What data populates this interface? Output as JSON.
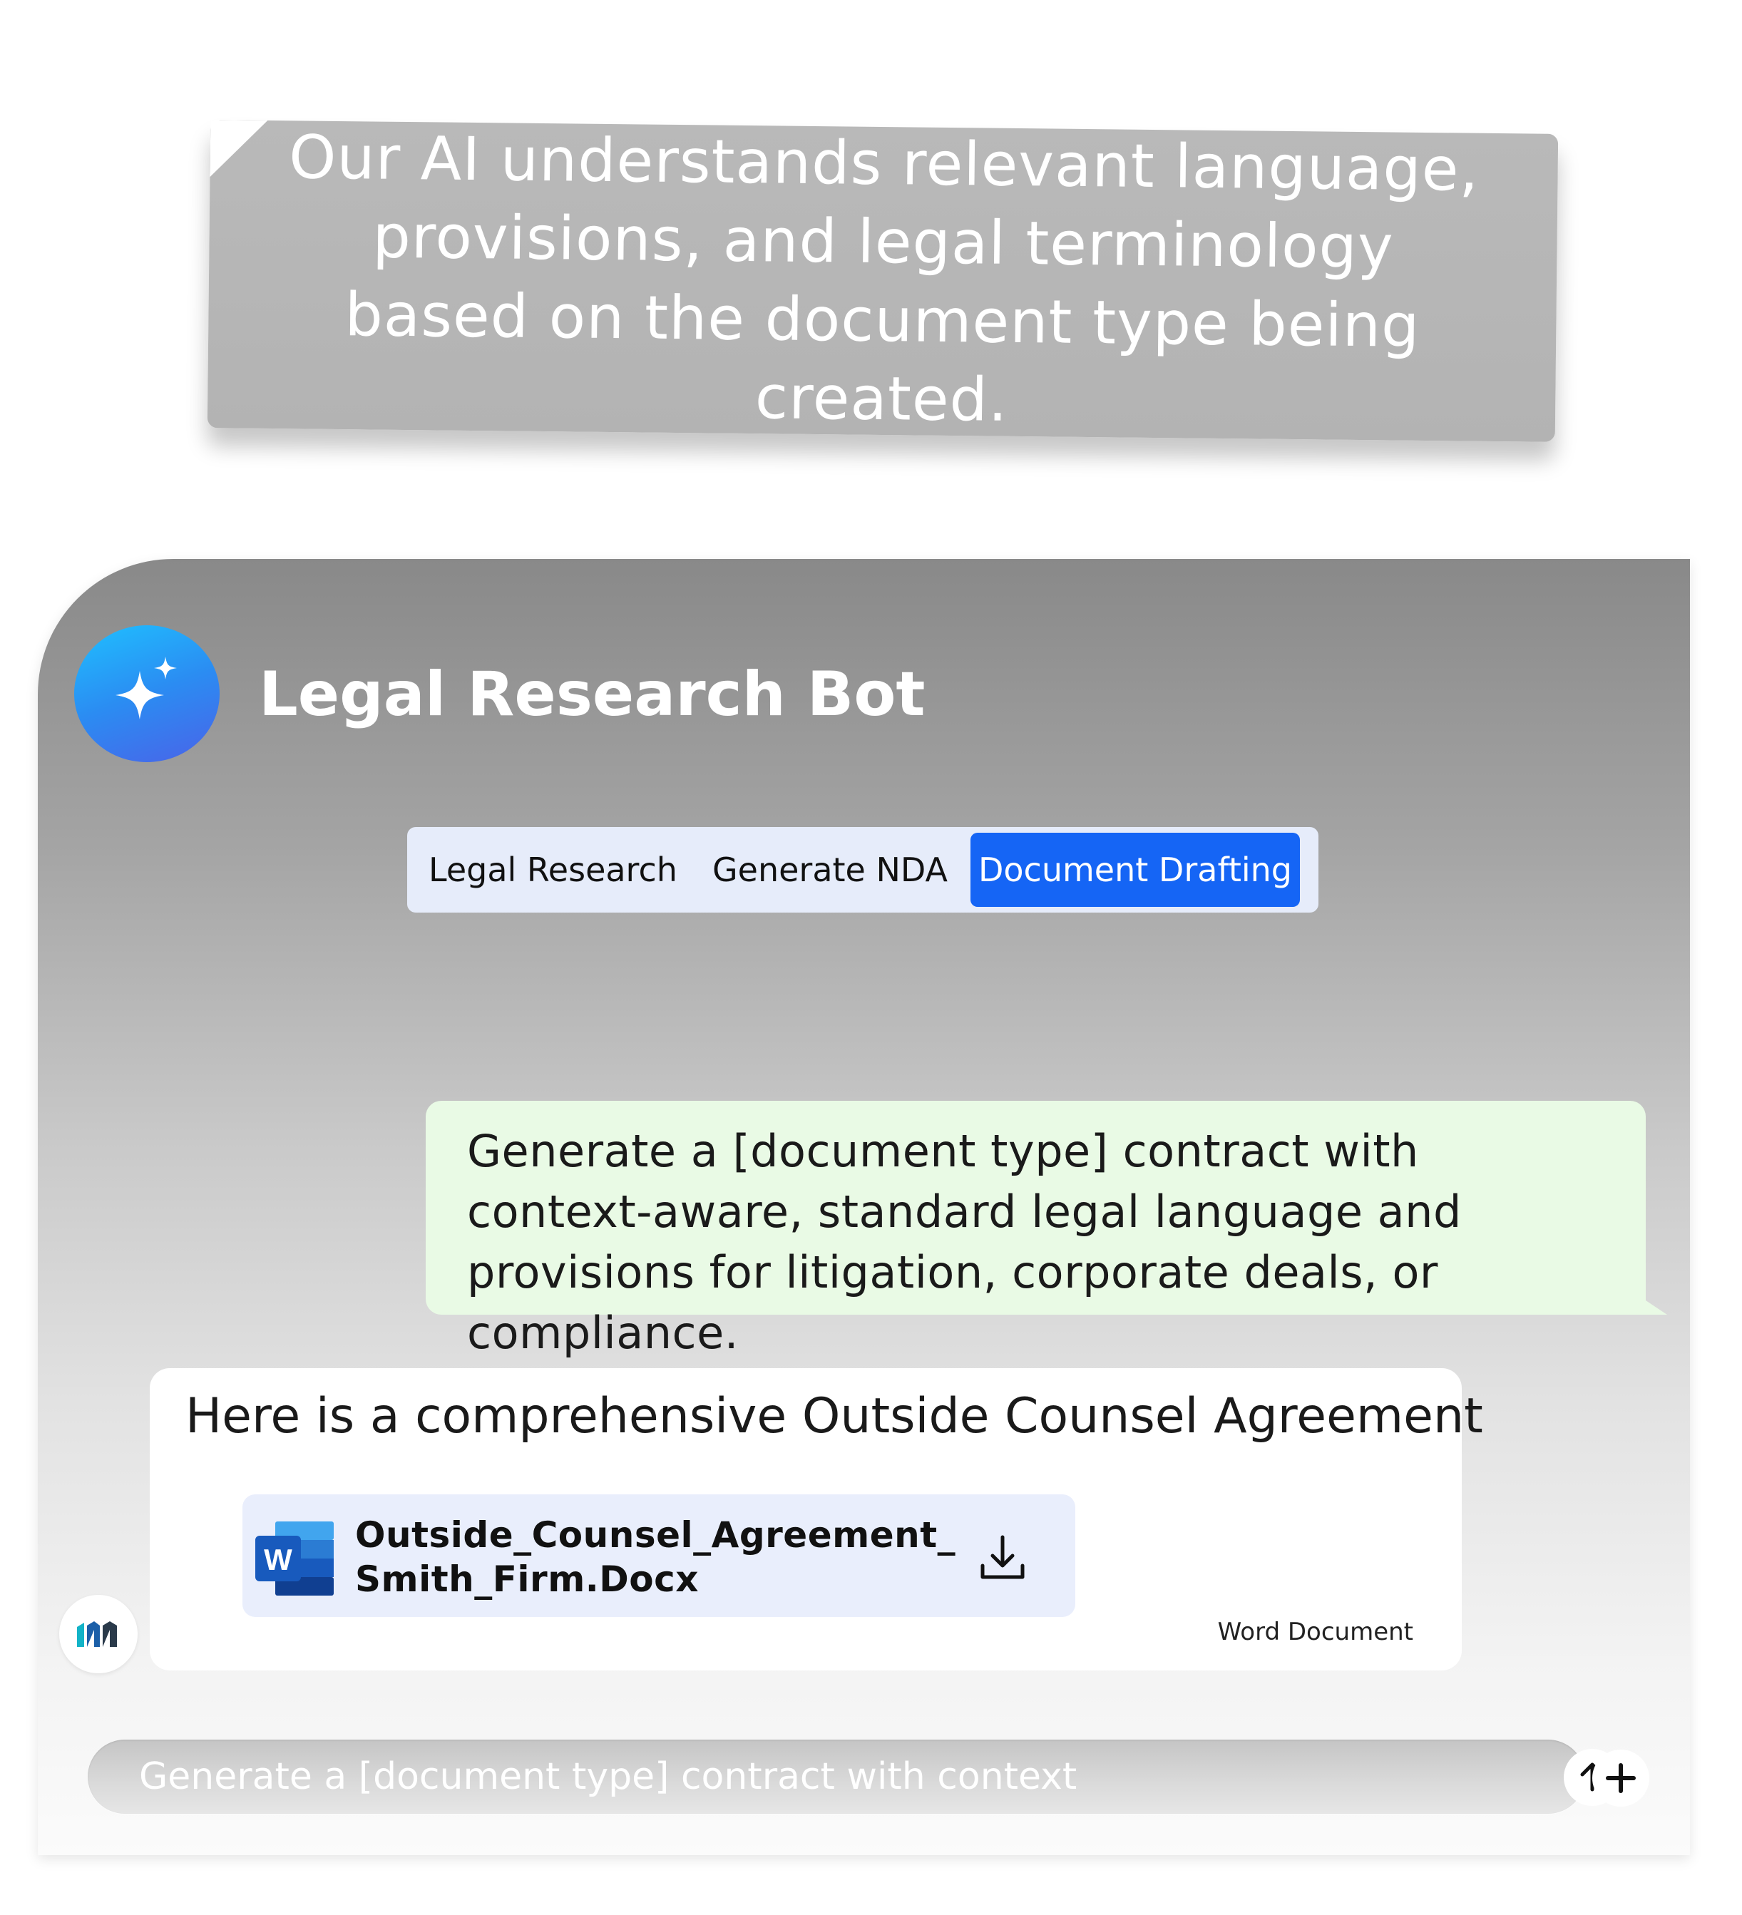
{
  "caption": {
    "text": "Our AI understands relevant language, provisions, and legal terminology based on the document type being created."
  },
  "header": {
    "title": "Legal Research Bot",
    "avatar_icon": "sparkle-icon"
  },
  "tabs": [
    {
      "label": "Legal Research",
      "active": false
    },
    {
      "label": "Generate NDA",
      "active": false
    },
    {
      "label": "Document Drafting",
      "active": true
    }
  ],
  "messages": {
    "user": {
      "text": "Generate a [document type] contract with context-aware, standard legal language and provisions for litigation, corporate deals, or compliance."
    },
    "bot": {
      "text": "Here is a comprehensive Outside Counsel Agreement",
      "attachment": {
        "name_line1": "Outside_Counsel_Agreement_",
        "name_line2": "Smith_Firm.Docx",
        "type": "Word Document",
        "icon": "word-icon"
      }
    }
  },
  "composer": {
    "placeholder": "Generate a [document type] contract with context",
    "send_icon": "arrow-up-icon",
    "add_icon": "plus-icon"
  },
  "colors": {
    "accent": "#1565f5",
    "user_bubble": "#e9fae5",
    "tabs_bg": "#e6ecfa",
    "file_card_bg": "#e9eefc"
  }
}
